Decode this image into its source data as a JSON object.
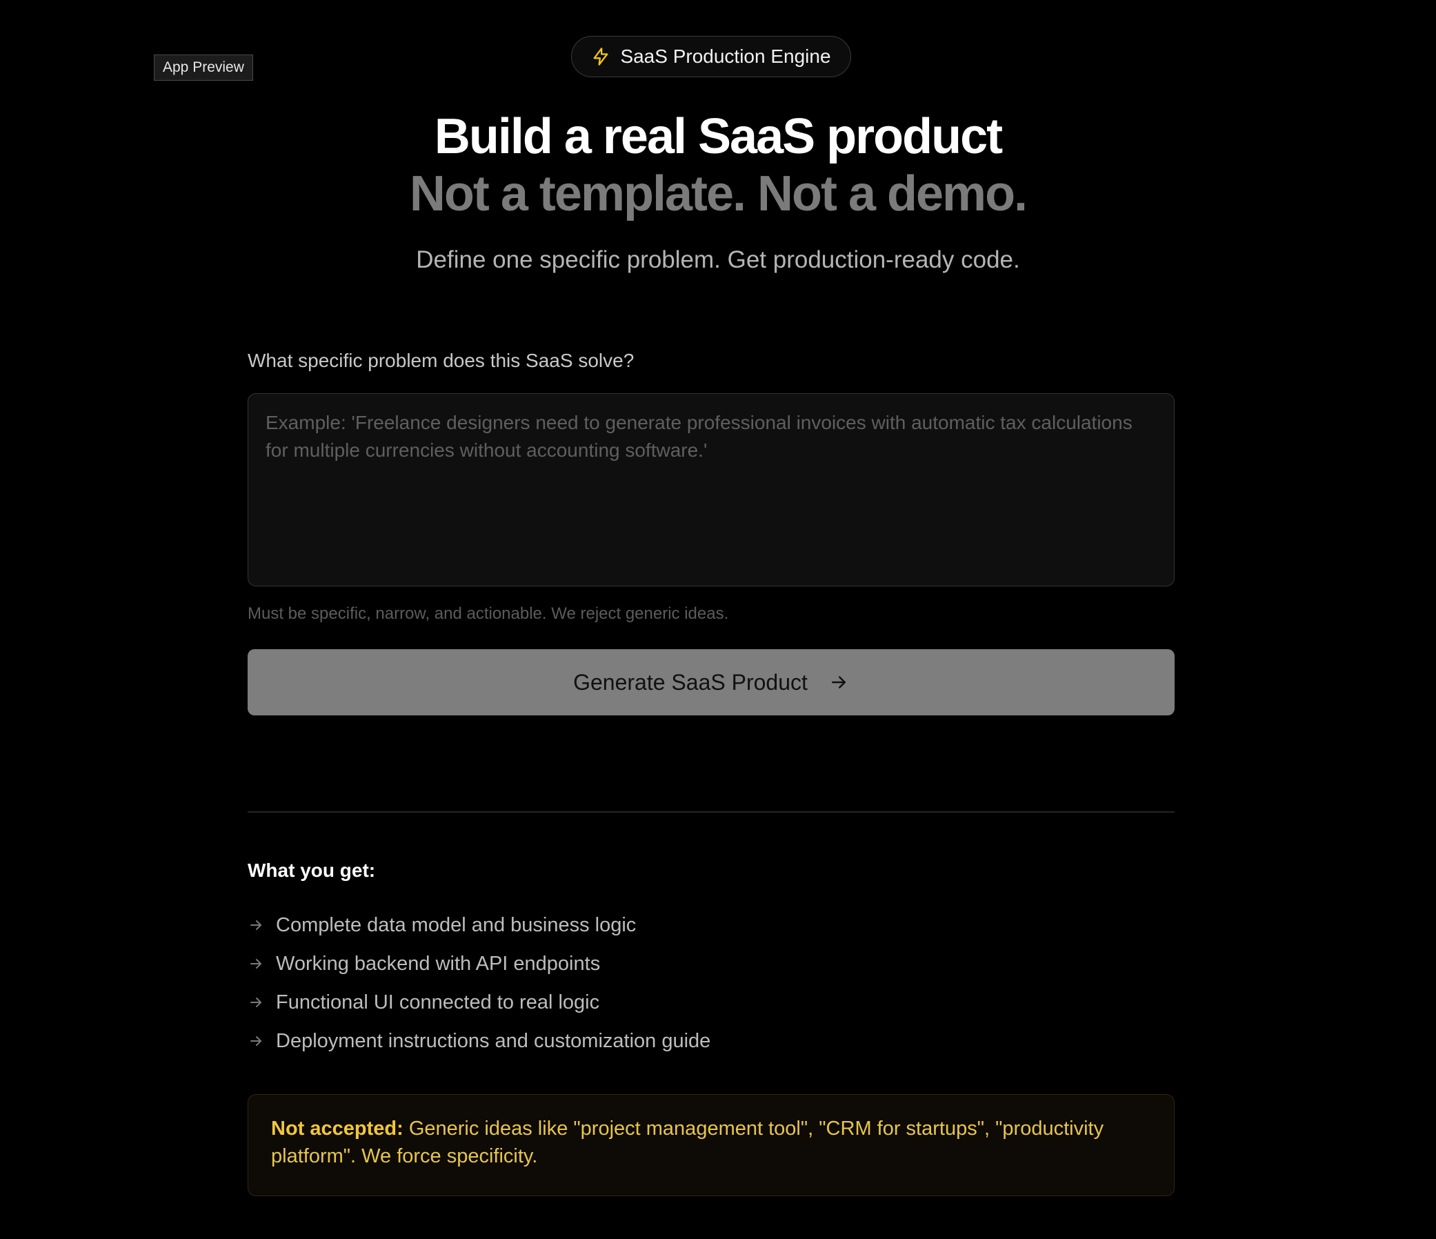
{
  "preview_tag": "App Preview",
  "badge": {
    "icon": "lightning-icon",
    "label": "SaaS Production Engine",
    "icon_color": "#f5c518"
  },
  "hero": {
    "title": "Build a real SaaS product",
    "subtitle": "Not a template. Not a demo.",
    "description": "Define one specific problem. Get production-ready code."
  },
  "form": {
    "label": "What specific problem does this SaaS solve?",
    "textarea": {
      "value": "",
      "placeholder": "Example: 'Freelance designers need to generate professional invoices with automatic tax calculations for multiple currencies without accounting software.'"
    },
    "hint": "Must be specific, narrow, and actionable. We reject generic ideas.",
    "submit_label": "Generate SaaS Product",
    "submit_icon": "arrow-right-icon"
  },
  "benefits": {
    "title": "What you get:",
    "items": [
      "Complete data model and business logic",
      "Working backend with API endpoints",
      "Functional UI connected to real logic",
      "Deployment instructions and customization guide"
    ]
  },
  "notice": {
    "strong": "Not accepted:",
    "text": " Generic ideas like \"project management tool\", \"CRM for startups\", \"productivity platform\". We force specificity.",
    "color": "#e7c64a"
  }
}
